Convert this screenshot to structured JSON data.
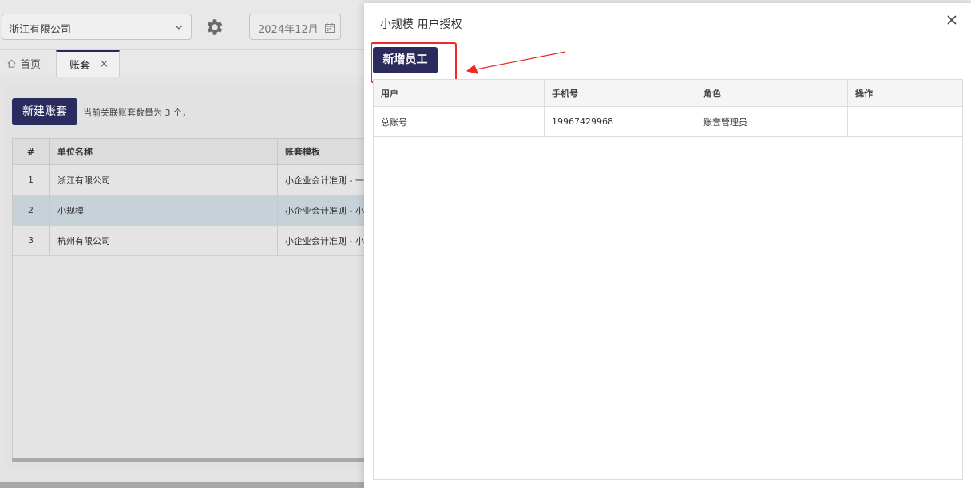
{
  "toolbar": {
    "company_value": "浙江有限公司",
    "date_value": "2024年12月"
  },
  "tabs": [
    {
      "label": "首页",
      "icon": "home-icon"
    },
    {
      "label": "账套",
      "closable": true
    }
  ],
  "accounts": {
    "new_button_label": "新建账套",
    "count_text": "当前关联账套数量为 3 个，",
    "columns": [
      "#",
      "单位名称",
      "账套模板"
    ],
    "rows": [
      {
        "idx": "1",
        "name": "浙江有限公司",
        "template": "小企业会计准则 - 一"
      },
      {
        "idx": "2",
        "name": "小规模",
        "template": "小企业会计准则 - 小",
        "selected": true
      },
      {
        "idx": "3",
        "name": "杭州有限公司",
        "template": "小企业会计准则 - 小"
      }
    ]
  },
  "drawer": {
    "title": "小规模 用户授权",
    "add_staff_label": "新增员工",
    "columns": [
      "用户",
      "手机号",
      "角色",
      "操作"
    ],
    "rows": [
      {
        "user": "总账号",
        "phone": "19967429968",
        "role": "账套管理员",
        "op": ""
      }
    ]
  },
  "colors": {
    "primary_button": "#2b2b5e",
    "highlight": "#ee2a24"
  }
}
